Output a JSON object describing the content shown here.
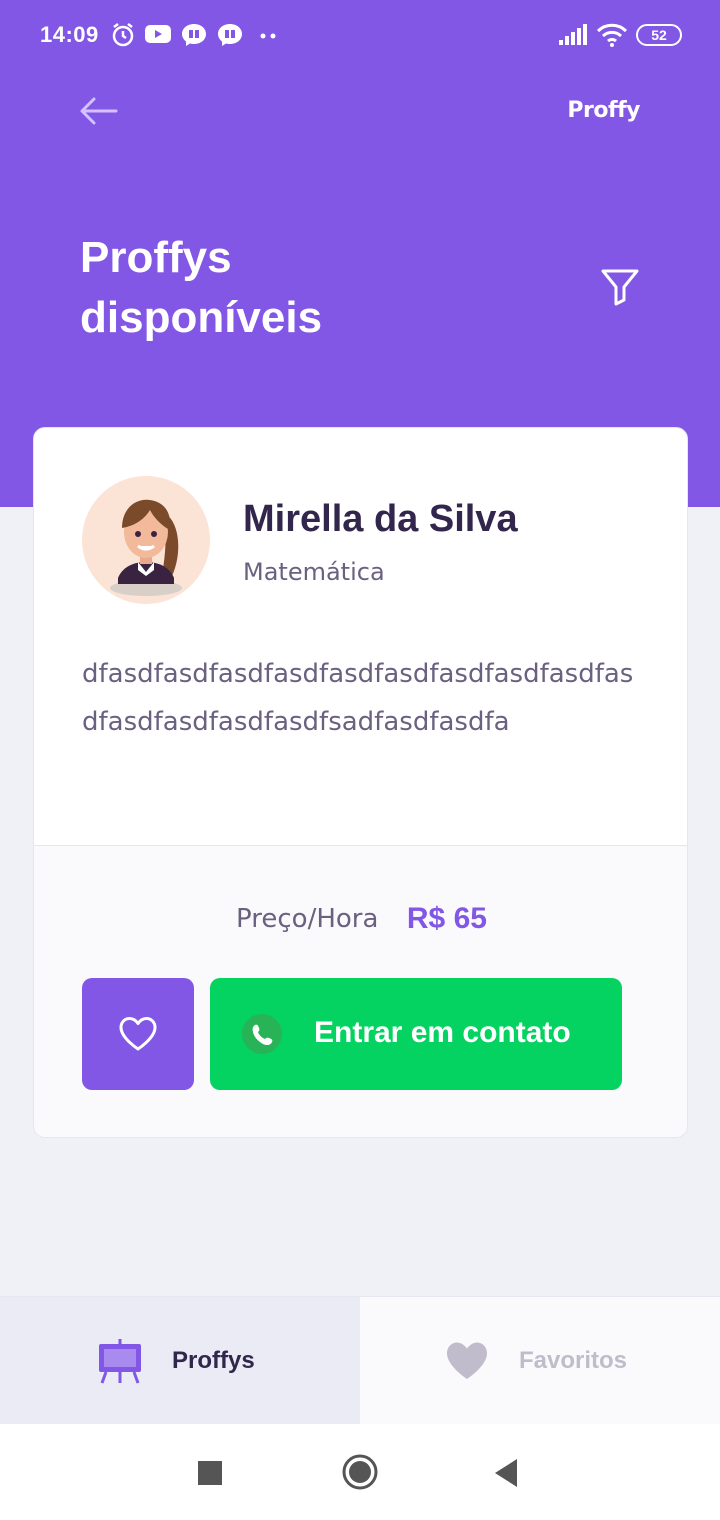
{
  "status_bar": {
    "time": "14:09",
    "battery": "52",
    "icons": [
      "alarm-icon",
      "youtube-icon",
      "messenger-icon",
      "messenger-icon",
      "more-dots-icon",
      "signal-icon",
      "wifi-icon",
      "battery-icon"
    ]
  },
  "header": {
    "brand": "Proffy",
    "title": "Proffys disponíveis",
    "back_icon": "arrow-left-icon",
    "filter_icon": "filter-icon",
    "background_color": "#8257E5"
  },
  "teacher_card": {
    "name": "Mirella da Silva",
    "subject": "Matemática",
    "bio": "dfasdfasdfasdfasdfasdfasdfasdfasdfasdfasdfasdfasdfasdfasdfsadfasdfasdfa",
    "price_label": "Preço/Hora",
    "price_value": "R$ 65",
    "contact_label": "Entrar em contato",
    "favorite_icon": "heart-outline-icon",
    "contact_icon": "whatsapp-icon",
    "accent_color": "#8257E5",
    "contact_color": "#04D361"
  },
  "tabs": [
    {
      "label": "Proffys",
      "icon": "easel-icon",
      "active": true
    },
    {
      "label": "Favoritos",
      "icon": "heart-icon",
      "active": false
    }
  ],
  "system_nav": [
    "recents-square-icon",
    "home-circle-icon",
    "back-triangle-icon"
  ]
}
